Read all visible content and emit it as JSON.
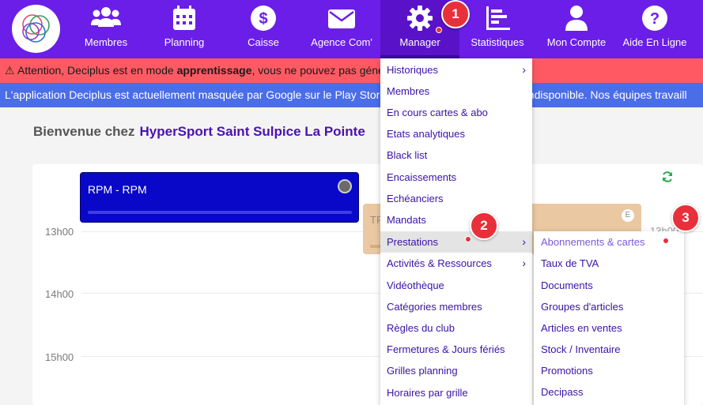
{
  "nav": {
    "items": [
      {
        "label": "Membres",
        "icon": "users-icon"
      },
      {
        "label": "Planning",
        "icon": "calendar-icon"
      },
      {
        "label": "Caisse",
        "icon": "dollar-icon"
      },
      {
        "label": "Agence Com'",
        "icon": "envelope-icon"
      },
      {
        "label": "Manager",
        "icon": "gear-icon"
      },
      {
        "label": "Statistiques",
        "icon": "chart-icon"
      },
      {
        "label": "Mon Compte",
        "icon": "user-icon"
      },
      {
        "label": "Aide En Ligne",
        "icon": "help-icon"
      }
    ],
    "accent": "#6b1ee8"
  },
  "banners": {
    "warning_prefix": "Attention, Deciplus est en mode ",
    "warning_bold": "apprentissage",
    "warning_suffix": ", vous ne pouvez pas géné",
    "info": "L'application Deciplus est actuellement masquée par Google sur le Play Store. Nos équipes travaillent ... t indisponible. Nos équipes travaill"
  },
  "welcome": {
    "prefix": "Bienvenue chez",
    "club": "HyperSport Saint Sulpice La Pointe"
  },
  "calendar": {
    "hours": [
      "13h00",
      "14h00",
      "15h00"
    ],
    "right_hour": "13h00",
    "events": [
      {
        "title": "RPM - RPM",
        "color": "#0a08c8"
      },
      {
        "title": "TR",
        "badge": "E",
        "color": "#e9c8a2"
      }
    ]
  },
  "manager_menu": {
    "items": [
      {
        "label": "Historiques",
        "submenu": true
      },
      {
        "label": "Membres"
      },
      {
        "label": "En cours cartes & abo"
      },
      {
        "label": "Etats analytiques"
      },
      {
        "label": "Black list"
      },
      {
        "label": "Encaissements"
      },
      {
        "label": "Echéanciers"
      },
      {
        "label": "Mandats"
      },
      {
        "label": "Prestations",
        "submenu": true,
        "highlighted": true
      },
      {
        "label": "Activités & Ressources",
        "submenu": true
      },
      {
        "label": "Vidéothèque"
      },
      {
        "label": "Catégories membres"
      },
      {
        "label": "Règles du club"
      },
      {
        "label": "Fermetures & Jours fériés"
      },
      {
        "label": "Grilles planning"
      },
      {
        "label": "Horaires par grille"
      }
    ]
  },
  "prestations_submenu": {
    "items": [
      "Abonnements & cartes",
      "Taux de TVA",
      "Documents",
      "Groupes d'articles",
      "Articles en ventes",
      "Stock / Inventaire",
      "Promotions",
      "Decipass"
    ]
  },
  "callouts": [
    "1",
    "2",
    "3"
  ]
}
